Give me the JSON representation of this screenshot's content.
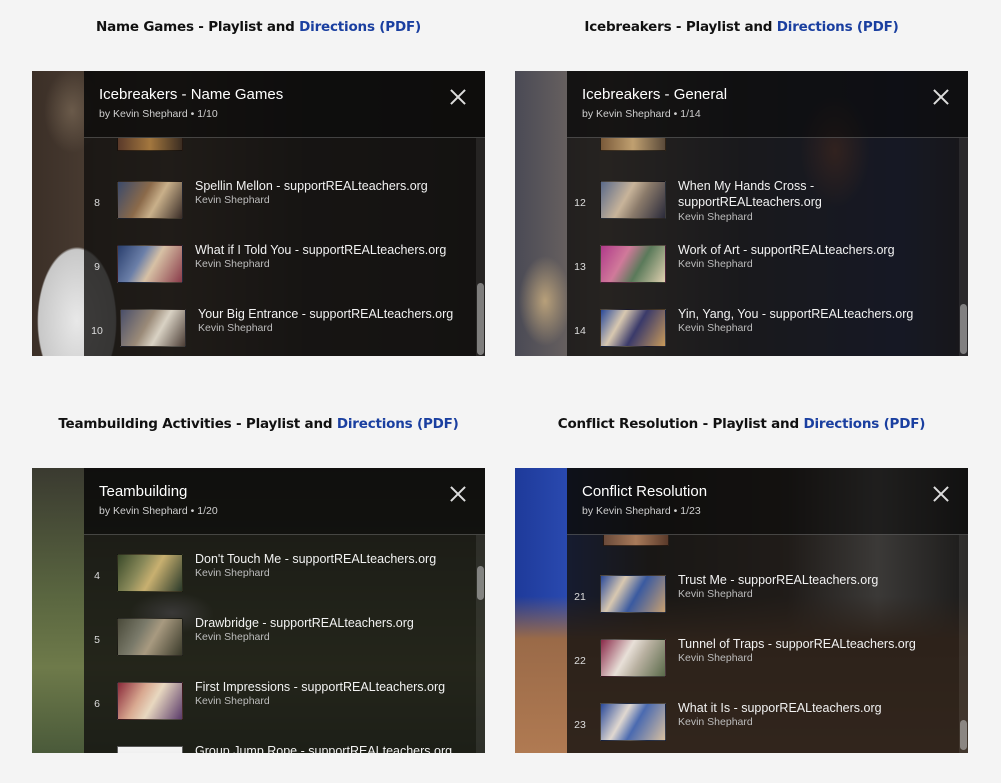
{
  "sections": [
    {
      "heading": {
        "prefix": "Name Games - Playlist and ",
        "link": "Directions (PDF)"
      },
      "playlist": {
        "title": "Icebreakers - Name Games",
        "meta": "by Kevin Shephard • 1/10",
        "items": [
          {
            "index": "8",
            "title": "Spellin Mellon - supportREALteachers.org",
            "author": "Kevin Shephard"
          },
          {
            "index": "9",
            "title": "What if I Told You - supportREALteachers.org",
            "author": "Kevin Shephard"
          },
          {
            "index": "10",
            "title": "Your Big Entrance - supportREALteachers.org",
            "author": "Kevin Shephard"
          }
        ]
      }
    },
    {
      "heading": {
        "prefix": "Icebreakers - Playlist and ",
        "link": "Directions (PDF)"
      },
      "playlist": {
        "title": "Icebreakers - General",
        "meta": "by Kevin Shephard • 1/14",
        "items": [
          {
            "index": "12",
            "title": "When My Hands Cross - supportREALteachers.org",
            "author": "Kevin Shephard"
          },
          {
            "index": "13",
            "title": "Work of Art - supportREALteachers.org",
            "author": "Kevin Shephard"
          },
          {
            "index": "14",
            "title": "Yin, Yang, You - supportREALteachers.org",
            "author": "Kevin Shephard"
          }
        ]
      }
    },
    {
      "heading": {
        "prefix": "Teambuilding Activities - Playlist and ",
        "link": "Directions (PDF)"
      },
      "playlist": {
        "title": "Teambuilding",
        "meta": "by Kevin Shephard • 1/20",
        "items": [
          {
            "index": "4",
            "title": "Don't Touch Me - supportREALteachers.org",
            "author": "Kevin Shephard"
          },
          {
            "index": "5",
            "title": "Drawbridge - supportREALteachers.org",
            "author": "Kevin Shephard"
          },
          {
            "index": "6",
            "title": "First Impressions - supportREALteachers.org",
            "author": "Kevin Shephard"
          },
          {
            "index": "",
            "title": "Group Jump Rope - supportREALteachers.org",
            "author": ""
          }
        ]
      }
    },
    {
      "heading": {
        "prefix": "Conflict Resolution - Playlist and ",
        "link": "Directions (PDF)"
      },
      "playlist": {
        "title": "Conflict Resolution",
        "meta": "by Kevin Shephard • 1/23",
        "items": [
          {
            "index": "21",
            "title": "Trust Me - supporREALteachers.org",
            "author": "Kevin Shephard"
          },
          {
            "index": "22",
            "title": "Tunnel of Traps - supporREALteachers.org",
            "author": "Kevin Shephard"
          },
          {
            "index": "23",
            "title": "What it Is - supporREALteachers.org",
            "author": "Kevin Shephard"
          }
        ]
      }
    }
  ],
  "colors": {
    "link": "#1a3fa0",
    "page_background": "#f4f4f4"
  }
}
